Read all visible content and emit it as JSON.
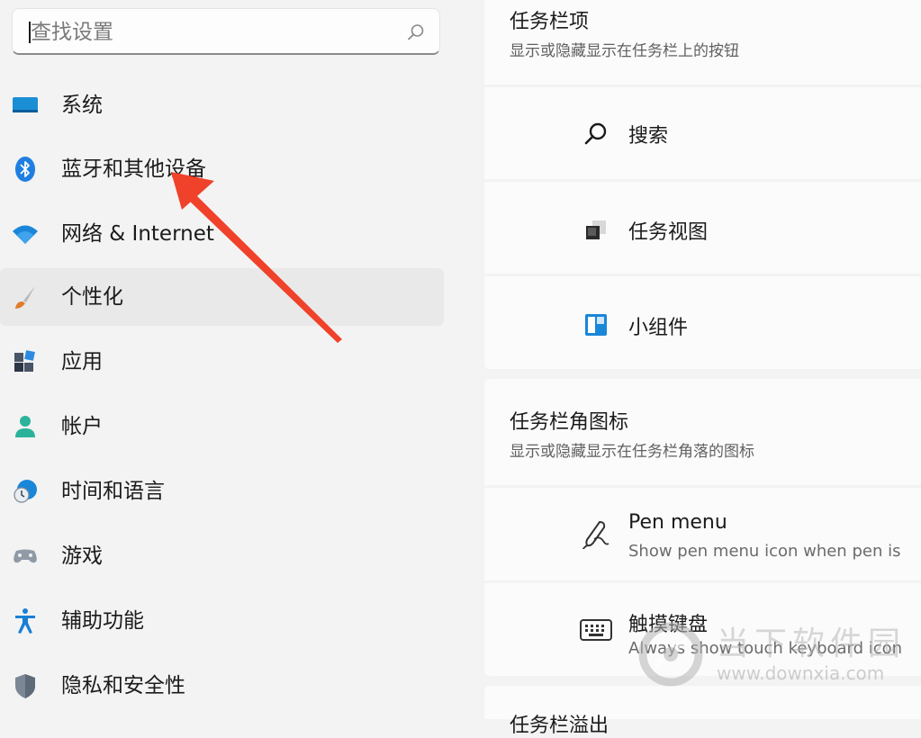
{
  "search": {
    "placeholder": "查找设置"
  },
  "nav": {
    "items": [
      {
        "label": "系统",
        "icon": "monitor-icon"
      },
      {
        "label": "蓝牙和其他设备",
        "icon": "bluetooth-icon"
      },
      {
        "label": "网络 & Internet",
        "icon": "wifi-icon"
      },
      {
        "label": "个性化",
        "icon": "paintbrush-icon",
        "active": true
      },
      {
        "label": "应用",
        "icon": "apps-icon"
      },
      {
        "label": "帐户",
        "icon": "account-icon"
      },
      {
        "label": "时间和语言",
        "icon": "clock-globe-icon"
      },
      {
        "label": "游戏",
        "icon": "gamepad-icon"
      },
      {
        "label": "辅助功能",
        "icon": "accessibility-icon"
      },
      {
        "label": "隐私和安全性",
        "icon": "shield-icon"
      }
    ]
  },
  "taskbar_items": {
    "title": "任务栏项",
    "subtitle": "显示或隐藏显示在任务栏上的按钮",
    "rows": [
      {
        "label": "搜索",
        "icon": "search-icon"
      },
      {
        "label": "任务视图",
        "icon": "task-view-icon"
      },
      {
        "label": "小组件",
        "icon": "widgets-icon"
      }
    ]
  },
  "corner_icons": {
    "title": "任务栏角图标",
    "subtitle": "显示或隐藏显示在任务栏角落的图标",
    "rows": [
      {
        "label": "Pen menu",
        "sub": "Show pen menu icon when pen is",
        "icon": "pen-icon"
      },
      {
        "label": "触摸键盘",
        "sub": "Always show touch keyboard icon",
        "icon": "keyboard-icon"
      }
    ]
  },
  "next_section": {
    "title": "任务栏溢出"
  },
  "watermark": {
    "title": "当下软件园",
    "url": "www.downxia.com"
  },
  "colors": {
    "accent": "#0067c0",
    "arrow": "#f0412a",
    "active_bg": "#e9e9e9"
  }
}
